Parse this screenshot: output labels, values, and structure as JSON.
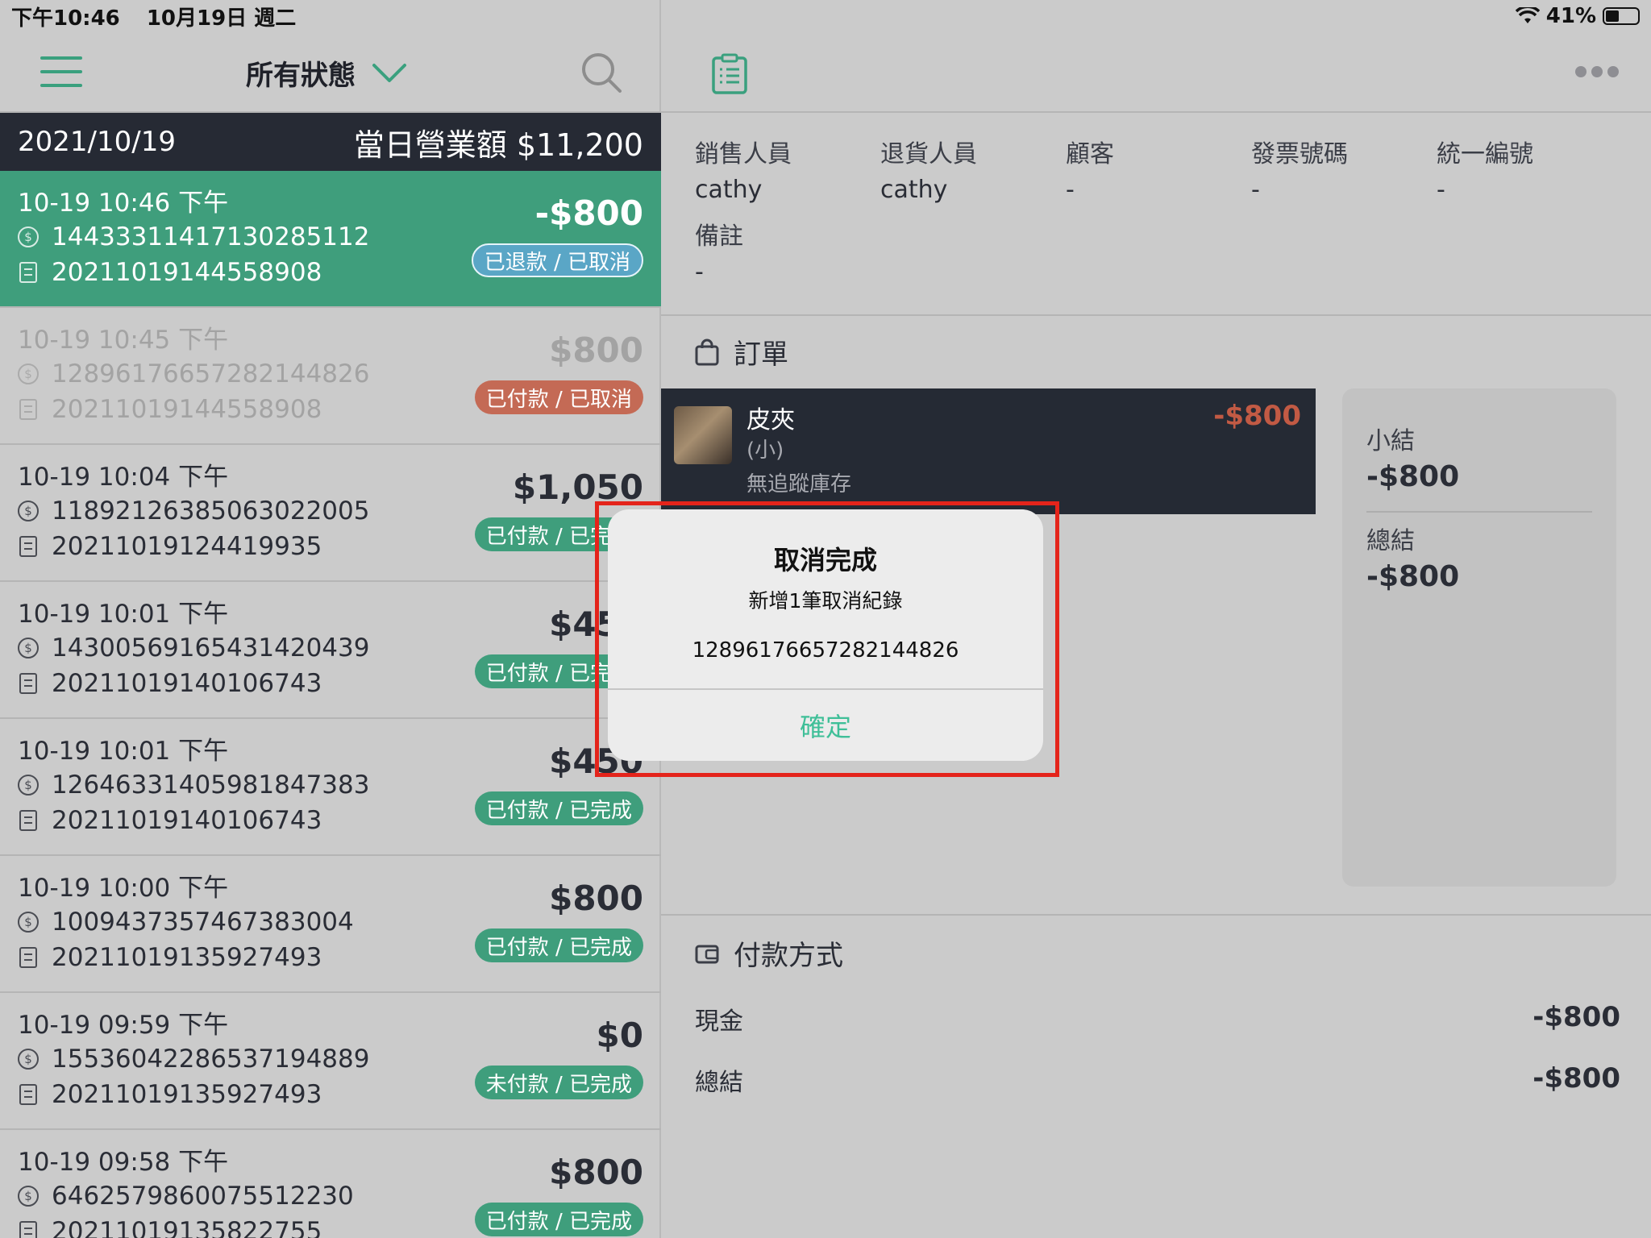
{
  "status_bar": {
    "time": "下午10:46",
    "date": "10月19日 週二",
    "battery": "41%"
  },
  "left_header": {
    "filter_label": "所有狀態"
  },
  "day_bar": {
    "date": "2021/10/19",
    "total": "當日營業額 $11,200"
  },
  "transactions": [
    {
      "time": "10-19 10:46 下午",
      "payment_id": "1443331141713028511​2",
      "order_no": "20211019144558908",
      "amount": "-$800",
      "status": "已退款 / 已取消"
    },
    {
      "time": "10-19 10:45 下午",
      "payment_id": "1289617665728214482​6",
      "order_no": "20211019144558908",
      "amount": "$800",
      "status": "已付款 / 已取消"
    },
    {
      "time": "10-19 10:04 下午",
      "payment_id": "1189212638506302200​5",
      "order_no": "20211019124419935",
      "amount": "$1,050",
      "status": "已付款 / 已完成"
    },
    {
      "time": "10-19 10:01 下午",
      "payment_id": "1430056916543142043​9",
      "order_no": "20211019140106743",
      "amount": "$450",
      "status": "已付款 / 已完成"
    },
    {
      "time": "10-19 10:01 下午",
      "payment_id": "1264633140598184738​3",
      "order_no": "20211019140106743",
      "amount": "$450",
      "status": "已付款 / 已完成"
    },
    {
      "time": "10-19 10:00 下午",
      "payment_id": "1009437357467383004",
      "order_no": "20211019135927493",
      "amount": "$800",
      "status": "已付款 / 已完成"
    },
    {
      "time": "10-19 09:59 下午",
      "payment_id": "1553604228653719488​9",
      "order_no": "20211019135927493",
      "amount": "$0",
      "status": "未付款 / 已完成"
    },
    {
      "time": "10-19 09:58 下午",
      "payment_id": "646257986007551223​0",
      "order_no": "20211019135822755",
      "amount": "$800",
      "status": "已付款 / 已完成"
    }
  ],
  "details": {
    "fields": [
      {
        "label": "銷售人員",
        "value": "cathy"
      },
      {
        "label": "退貨人員",
        "value": "cathy"
      },
      {
        "label": "顧客",
        "value": "-"
      },
      {
        "label": "發票號碼",
        "value": "-"
      },
      {
        "label": "統一編號",
        "value": "-"
      }
    ],
    "note": {
      "label": "備註",
      "value": "-"
    }
  },
  "order": {
    "title": "訂單",
    "item": {
      "name": "皮夾",
      "variant": "(小)",
      "stock": "無追蹤庫存",
      "price": "-$800"
    },
    "summary": {
      "subtotal_label": "小結",
      "subtotal": "-$800",
      "total_label": "總結",
      "total": "-$800"
    }
  },
  "payment": {
    "title": "付款方式",
    "rows": [
      {
        "label": "現金",
        "value": "-$800"
      },
      {
        "label": "總結",
        "value": "-$800"
      }
    ]
  },
  "alert": {
    "title": "取消完成",
    "subtitle": "新增1筆取消紀錄",
    "number": "1289617665728214482​6",
    "confirm": "確定"
  }
}
